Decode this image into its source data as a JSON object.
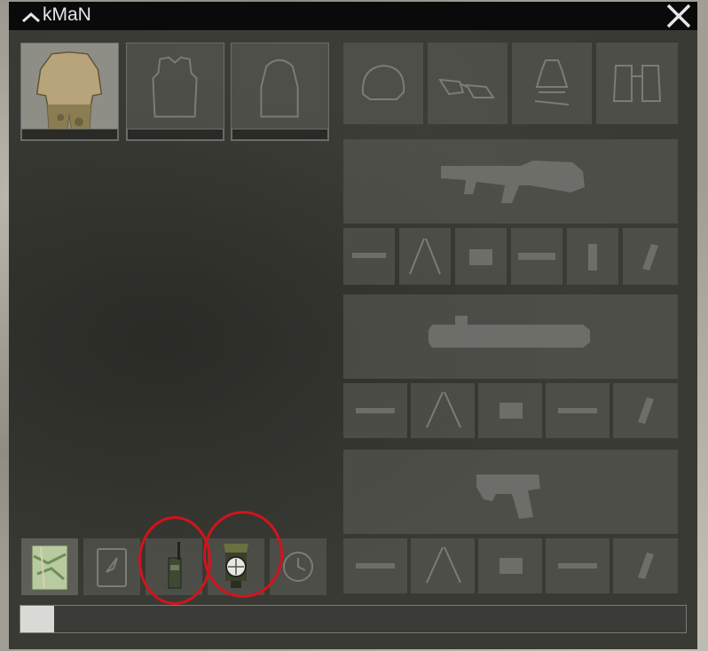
{
  "window": {
    "title": "kMaN"
  },
  "gear_slots": [
    {
      "name": "uniform",
      "equipped": true
    },
    {
      "name": "vest",
      "equipped": false
    },
    {
      "name": "backpack",
      "equipped": false
    }
  ],
  "assigned_items": [
    {
      "name": "map",
      "equipped": true
    },
    {
      "name": "gps",
      "equipped": false
    },
    {
      "name": "radio",
      "equipped": true
    },
    {
      "name": "compass",
      "equipped": true
    },
    {
      "name": "watch",
      "equipped": false
    }
  ],
  "load": {
    "fraction": 0.05
  },
  "annotation_color": "#d1141b"
}
